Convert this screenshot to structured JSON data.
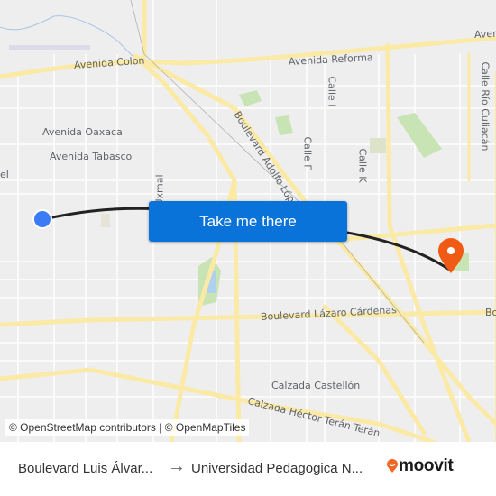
{
  "map": {
    "street_labels": [
      {
        "text": "Avenida Colon"
      },
      {
        "text": "Avenida Reforma"
      },
      {
        "text": "Aven"
      },
      {
        "text": "Avenida Oaxaca"
      },
      {
        "text": "Avenida Tabasco"
      },
      {
        "text": "el"
      },
      {
        "text": "Uxmal"
      },
      {
        "text": "Boulevard Adolfo López M"
      },
      {
        "text": "Calle I"
      },
      {
        "text": "Calle F"
      },
      {
        "text": "Calle K"
      },
      {
        "text": "Calle Río Culiacán"
      },
      {
        "text": "Boulevard Lázaro Cárdenas"
      },
      {
        "text": "Bo"
      },
      {
        "text": "Calzada Castellón"
      },
      {
        "text": "Calzada Héctor Terán Terán"
      }
    ],
    "origin_marker_color": "#3b7bf5",
    "destination_marker_color": "#f05a14",
    "route_color": "#222222"
  },
  "cta": {
    "label": "Take me there",
    "color": "#0a73d9"
  },
  "attribution": "© OpenStreetMap contributors | © OpenMapTiles",
  "footer": {
    "from": "Boulevard Luis Álvar...",
    "arrow": "→",
    "to": "Universidad Pedagogica N...",
    "brand": "moovit",
    "brand_color": "#f26522"
  }
}
